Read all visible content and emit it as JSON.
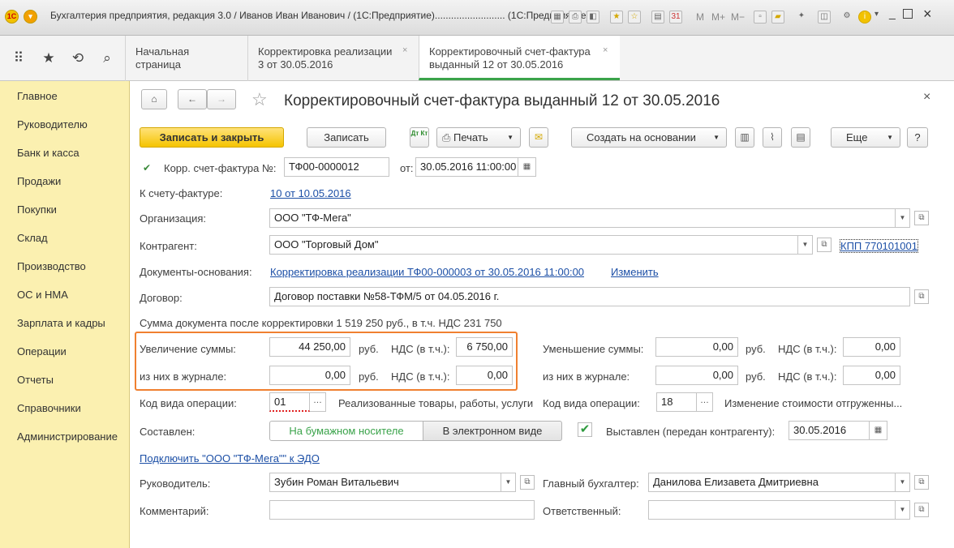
{
  "window": {
    "title": "Бухгалтерия предприятия, редакция 3.0 / Иванов Иван Иванович / (1С:Предприятие).......................... (1С:Предприятие)",
    "logo_text": "1С",
    "toolbar_icons": [
      "save-icon",
      "print-icon",
      "preview-icon",
      "favorites-add-icon",
      "favorites-icon",
      "calculator-icon",
      "calendar-icon"
    ],
    "memory_labels": [
      "M",
      "M+",
      "M−"
    ]
  },
  "tabs": [
    {
      "label_line1": "Начальная страница",
      "label_line2": ""
    },
    {
      "label_line1": "Корректировка реализации",
      "label_line2": "3 от 30.05.2016",
      "close": "×"
    },
    {
      "label_line1": "Корректировочный счет-фактура",
      "label_line2": "выданный 12 от 30.05.2016",
      "close": "×"
    }
  ],
  "sidebar": {
    "items": [
      "Главное",
      "Руководителю",
      "Банк и касса",
      "Продажи",
      "Покупки",
      "Склад",
      "Производство",
      "ОС и НМА",
      "Зарплата и кадры",
      "Операции",
      "Отчеты",
      "Справочники",
      "Администрирование"
    ]
  },
  "form": {
    "title": "Корректировочный счет-фактура выданный 12 от 30.05.2016",
    "close": "×",
    "toolbar": {
      "save_close": "Записать и закрыть",
      "save": "Записать",
      "print": "Печать",
      "create_based": "Создать на основании",
      "more": "Еще",
      "help": "?",
      "dt_kt": "Дт Кт"
    },
    "number_label": "Корр. счет-фактура №:",
    "number_value": "ТФ00-0000012",
    "date_label": "от:",
    "date_value": "30.05.2016 11:00:00",
    "invoice_label": "К счету-фактуре:",
    "invoice_link": "10 от 10.05.2016",
    "org_label": "Организация:",
    "org_value": "ООО \"ТФ-Мега\"",
    "counterparty_label": "Контрагент:",
    "counterparty_value": "ООО \"Торговый Дом\"",
    "kpp_link": "КПП 770101001",
    "basis_label": "Документы-основания:",
    "basis_link": "Корректировка реализации ТФ00-000003 от 30.05.2016 11:00:00",
    "basis_change": "Изменить",
    "contract_label": "Договор:",
    "contract_value": "Договор поставки №58-ТФМ/5 от 04.05.2016 г.",
    "sum_after": "Сумма документа после корректировки 1 519 250 руб., в т.ч. НДС 231 750",
    "increase_label": "Увеличение суммы:",
    "increase_value": "44 250,00",
    "rub": "руб.",
    "vat_label": "НДС (в т.ч.):",
    "increase_vat": "6 750,00",
    "journal_label": "из них в журнале:",
    "journal_value": "0,00",
    "journal_vat": "0,00",
    "decrease_label": "Уменьшение суммы:",
    "decrease_value": "0,00",
    "decrease_vat": "0,00",
    "dec_journal_value": "0,00",
    "dec_journal_vat": "0,00",
    "op_code_label": "Код вида операции:",
    "op_code_value": "01",
    "op_code_desc": "Реализованные товары, работы, услуги",
    "op_code2_label": "Код вида операции:",
    "op_code2_value": "18",
    "op_code2_desc": "Изменение стоимости отгруженны...",
    "composed_label": "Составлен:",
    "paper": "На бумажном носителе",
    "electronic": "В электронном виде",
    "issued_label": "Выставлен (передан контрагенту):",
    "issued_date": "30.05.2016",
    "edo_link": "Подключить \"ООО \"ТФ-Мега\"\" к ЭДО",
    "head_label": "Руководитель:",
    "head_value": "Зубин Роман Витальевич",
    "chief_acc_label": "Главный бухгалтер:",
    "chief_acc_value": "Данилова Елизавета Дмитриевна",
    "comment_label": "Комментарий:",
    "comment_value": "",
    "responsible_label": "Ответственный:",
    "responsible_value": ""
  },
  "colors": {
    "primary_button": "#f5c400",
    "sidebar": "#fbf0b0",
    "highlight_box": "#f08030",
    "link": "#1c4fa6",
    "active_tab_underline": "#3aa34a"
  }
}
